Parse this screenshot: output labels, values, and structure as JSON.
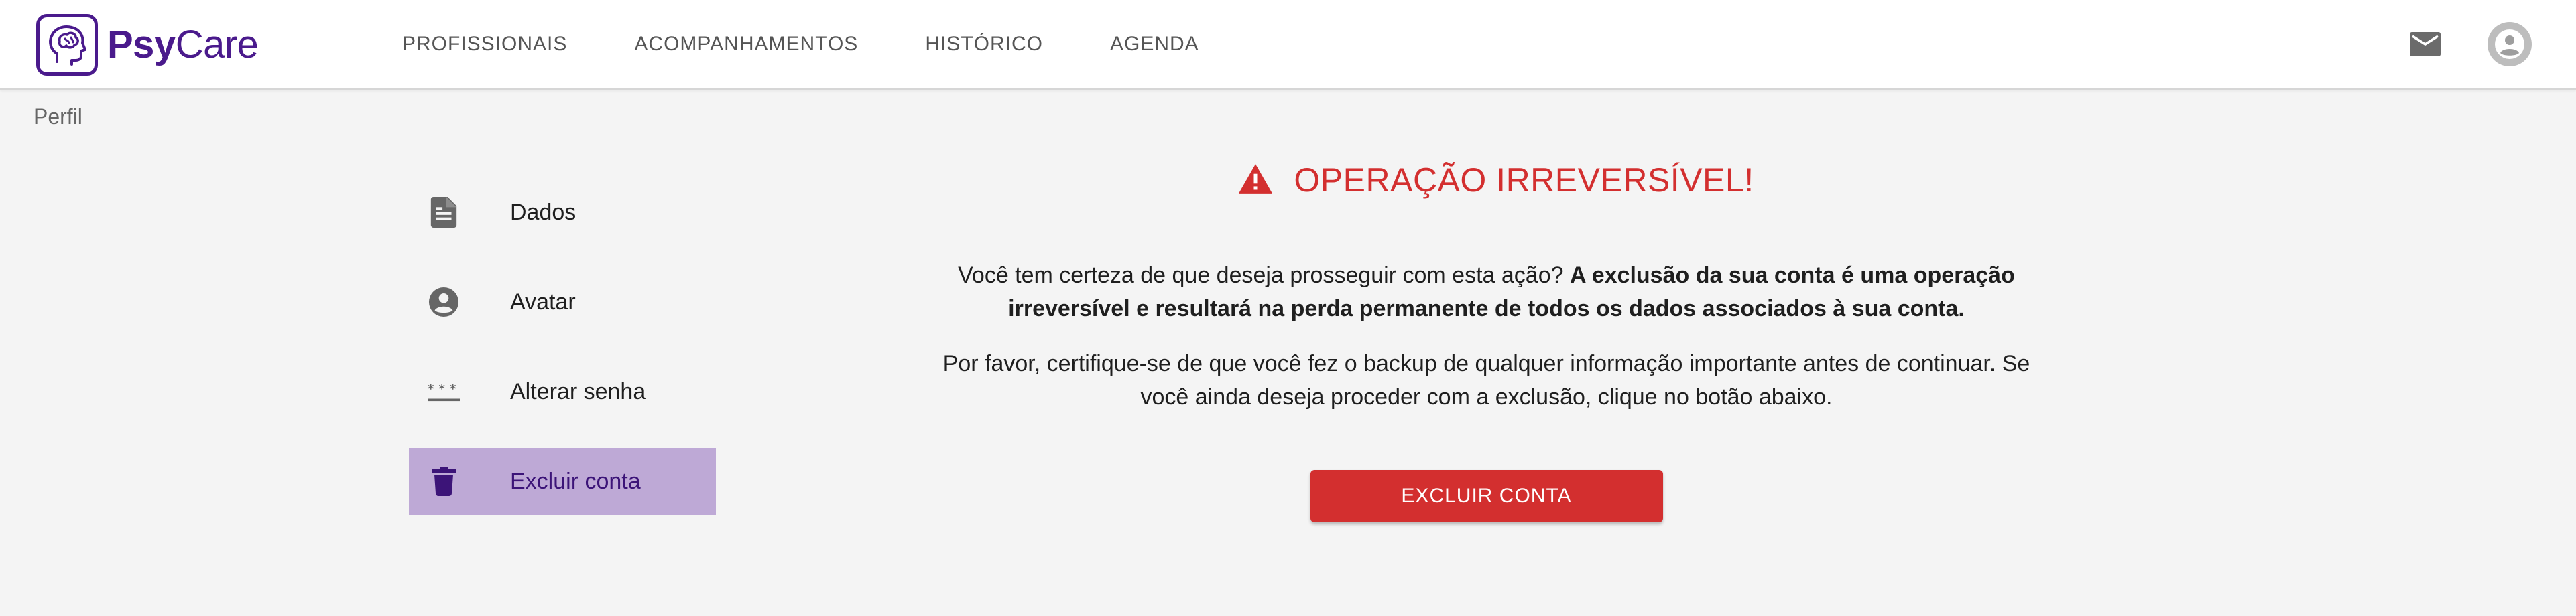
{
  "brand": {
    "name_bold": "Psy",
    "name_regular": "Care",
    "accent": "#4a1a8c"
  },
  "nav": [
    {
      "label": "PROFISSIONAIS"
    },
    {
      "label": "ACOMPANHAMENTOS"
    },
    {
      "label": "HISTÓRICO"
    },
    {
      "label": "AGENDA"
    }
  ],
  "topbar_icons": {
    "mail": "mail-icon",
    "avatar": "account-icon"
  },
  "breadcrumb": "Perfil",
  "menu": [
    {
      "label": "Dados",
      "icon": "document-icon",
      "active": false
    },
    {
      "label": "Avatar",
      "icon": "account-circle-icon",
      "active": false
    },
    {
      "label": "Alterar senha",
      "icon": "password-icon",
      "active": false
    },
    {
      "label": "Excluir conta",
      "icon": "trash-icon",
      "active": true
    }
  ],
  "main": {
    "title": "OPERAÇÃO IRREVERSÍVEL!",
    "p1_regular": "Você tem certeza de que deseja prosseguir com esta ação? ",
    "p1_bold": "A exclusão da sua conta é uma operação irreversível e resultará na perda permanente de todos os dados associados à sua conta.",
    "p2": "Por favor, certifique-se de que você fez o backup de qualquer informação importante antes de continuar. Se você ainda deseja proceder com a exclusão, clique no botão abaixo.",
    "button": "EXCLUIR CONTA"
  },
  "colors": {
    "danger": "#d32f2f",
    "active_bg": "#bea9d6",
    "background": "#f4f4f4"
  }
}
